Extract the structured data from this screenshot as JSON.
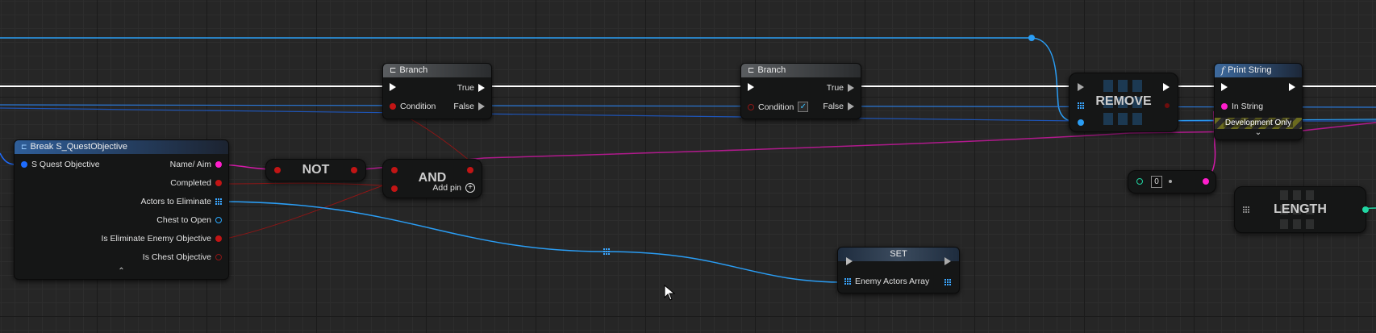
{
  "colors": {
    "exec": "#ffffff",
    "bool": "#c21515",
    "string": "#ff1ecc",
    "struct": "#1e6cff",
    "object": "#2aa8ff",
    "int": "#21d6a3"
  },
  "nodes": {
    "branch1": {
      "title": "Branch",
      "condition": "Condition",
      "true": "True",
      "false": "False"
    },
    "branch2": {
      "title": "Branch",
      "condition": "Condition",
      "true": "True",
      "false": "False"
    },
    "break_struct": {
      "title": "Break S_QuestObjective",
      "input": "S Quest Objective",
      "outputs": [
        "Name/ Aim",
        "Completed",
        "Actors to Eliminate",
        "Chest to Open",
        "Is Eliminate Enemy Objective",
        "Is Chest Objective"
      ],
      "collapse_icon": "chevron-up-icon"
    },
    "not_node": {
      "label": "NOT"
    },
    "and_node": {
      "label": "AND",
      "add_pin": "Add pin"
    },
    "set_node": {
      "title": "SET",
      "variable": "Enemy Actors Array"
    },
    "remove_node": {
      "label": "REMOVE"
    },
    "print_string": {
      "title": "Print String",
      "in_string": "In String",
      "dev_only": "Development Only",
      "expand_icon": "chevron-down-icon"
    },
    "int_literal": {
      "value": "0"
    },
    "length_node": {
      "label": "LENGTH"
    }
  }
}
